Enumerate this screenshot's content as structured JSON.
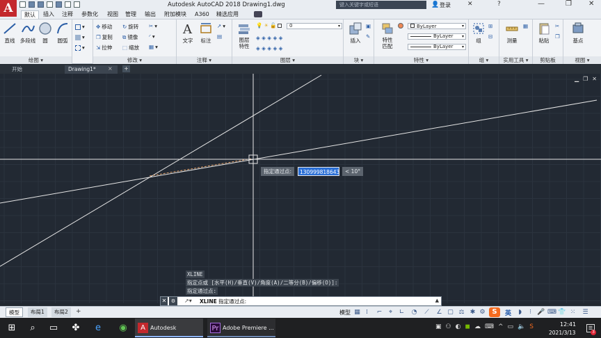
{
  "app": {
    "logo_letter": "A",
    "window_title": "Autodesk AutoCAD 2018    Drawing1.dwg",
    "search_placeholder": "键入关键字或短语",
    "login_label": "登录"
  },
  "ribbon_tabs": [
    "默认",
    "插入",
    "注释",
    "参数化",
    "视图",
    "管理",
    "输出",
    "附加模块",
    "A360",
    "精选应用"
  ],
  "ribbon": {
    "draw": {
      "group_label": "绘图 ▾",
      "line": "直线",
      "polyline": "多段线",
      "circle": "圆",
      "arc": "圆弧"
    },
    "modify": {
      "group_label": "修改 ▾",
      "move": "移动",
      "copy": "复制",
      "stretch": "拉伸",
      "rotate": "旋转",
      "mirror": "镜像",
      "scale": "缩放"
    },
    "annotation": {
      "group_label": "注释 ▾",
      "text": "文字",
      "dimension": "标注"
    },
    "layers": {
      "group_label": "图层 ▾",
      "layer_props": "图层\n特性",
      "layer_dropdown": "0"
    },
    "block": {
      "group_label": "块 ▾",
      "insert": "插入"
    },
    "properties": {
      "group_label": "特性 ▾",
      "match": "特性\n匹配",
      "color": "ByLayer",
      "linetype": "ByLayer",
      "lineweight": "ByLayer"
    },
    "groups": {
      "group_label": "组 ▾",
      "group": "组"
    },
    "utilities": {
      "group_label": "实用工具 ▾",
      "measure": "测量"
    },
    "clipboard": {
      "group_label": "剪贴板",
      "paste": "粘贴"
    },
    "view": {
      "group_label": "视图 ▾",
      "base": "基点"
    }
  },
  "doc_tabs": {
    "start": "开始",
    "drawing": "Drawing1*",
    "close": "×",
    "add": "+"
  },
  "viewport_controls": [
    "▁",
    "❐",
    "✕"
  ],
  "dynamic_input": {
    "prompt": "指定通过点:",
    "value": "130999818643",
    "angle": "< 10°"
  },
  "command_history": [
    "XLINE",
    "指定点或 [水平(H)/垂直(V)/角度(A)/二等分(B)/偏移(O)]:",
    "指定通过点:"
  ],
  "command_line": {
    "command": "XLINE",
    "prompt": "指定通过点:",
    "close": "✕",
    "wrench": "🔧"
  },
  "layout_tabs": [
    "模型",
    "布局1",
    "布局2"
  ],
  "layout_add": "+",
  "status": {
    "model": "模型",
    "ime": "英"
  },
  "taskbar": {
    "apps": [
      {
        "name": "Autodesk AutoCA...",
        "icon": "A"
      },
      {
        "name": "Adobe Premiere ...",
        "icon": "Pr"
      }
    ],
    "time": "12:41",
    "date": "2021/3/13",
    "notify_count": "3"
  },
  "colors": {
    "viewport_bg": "#222933",
    "crosshair": "#e8e8e8",
    "accent": "#c3282d",
    "input_highlight": "#2a6fd6"
  }
}
